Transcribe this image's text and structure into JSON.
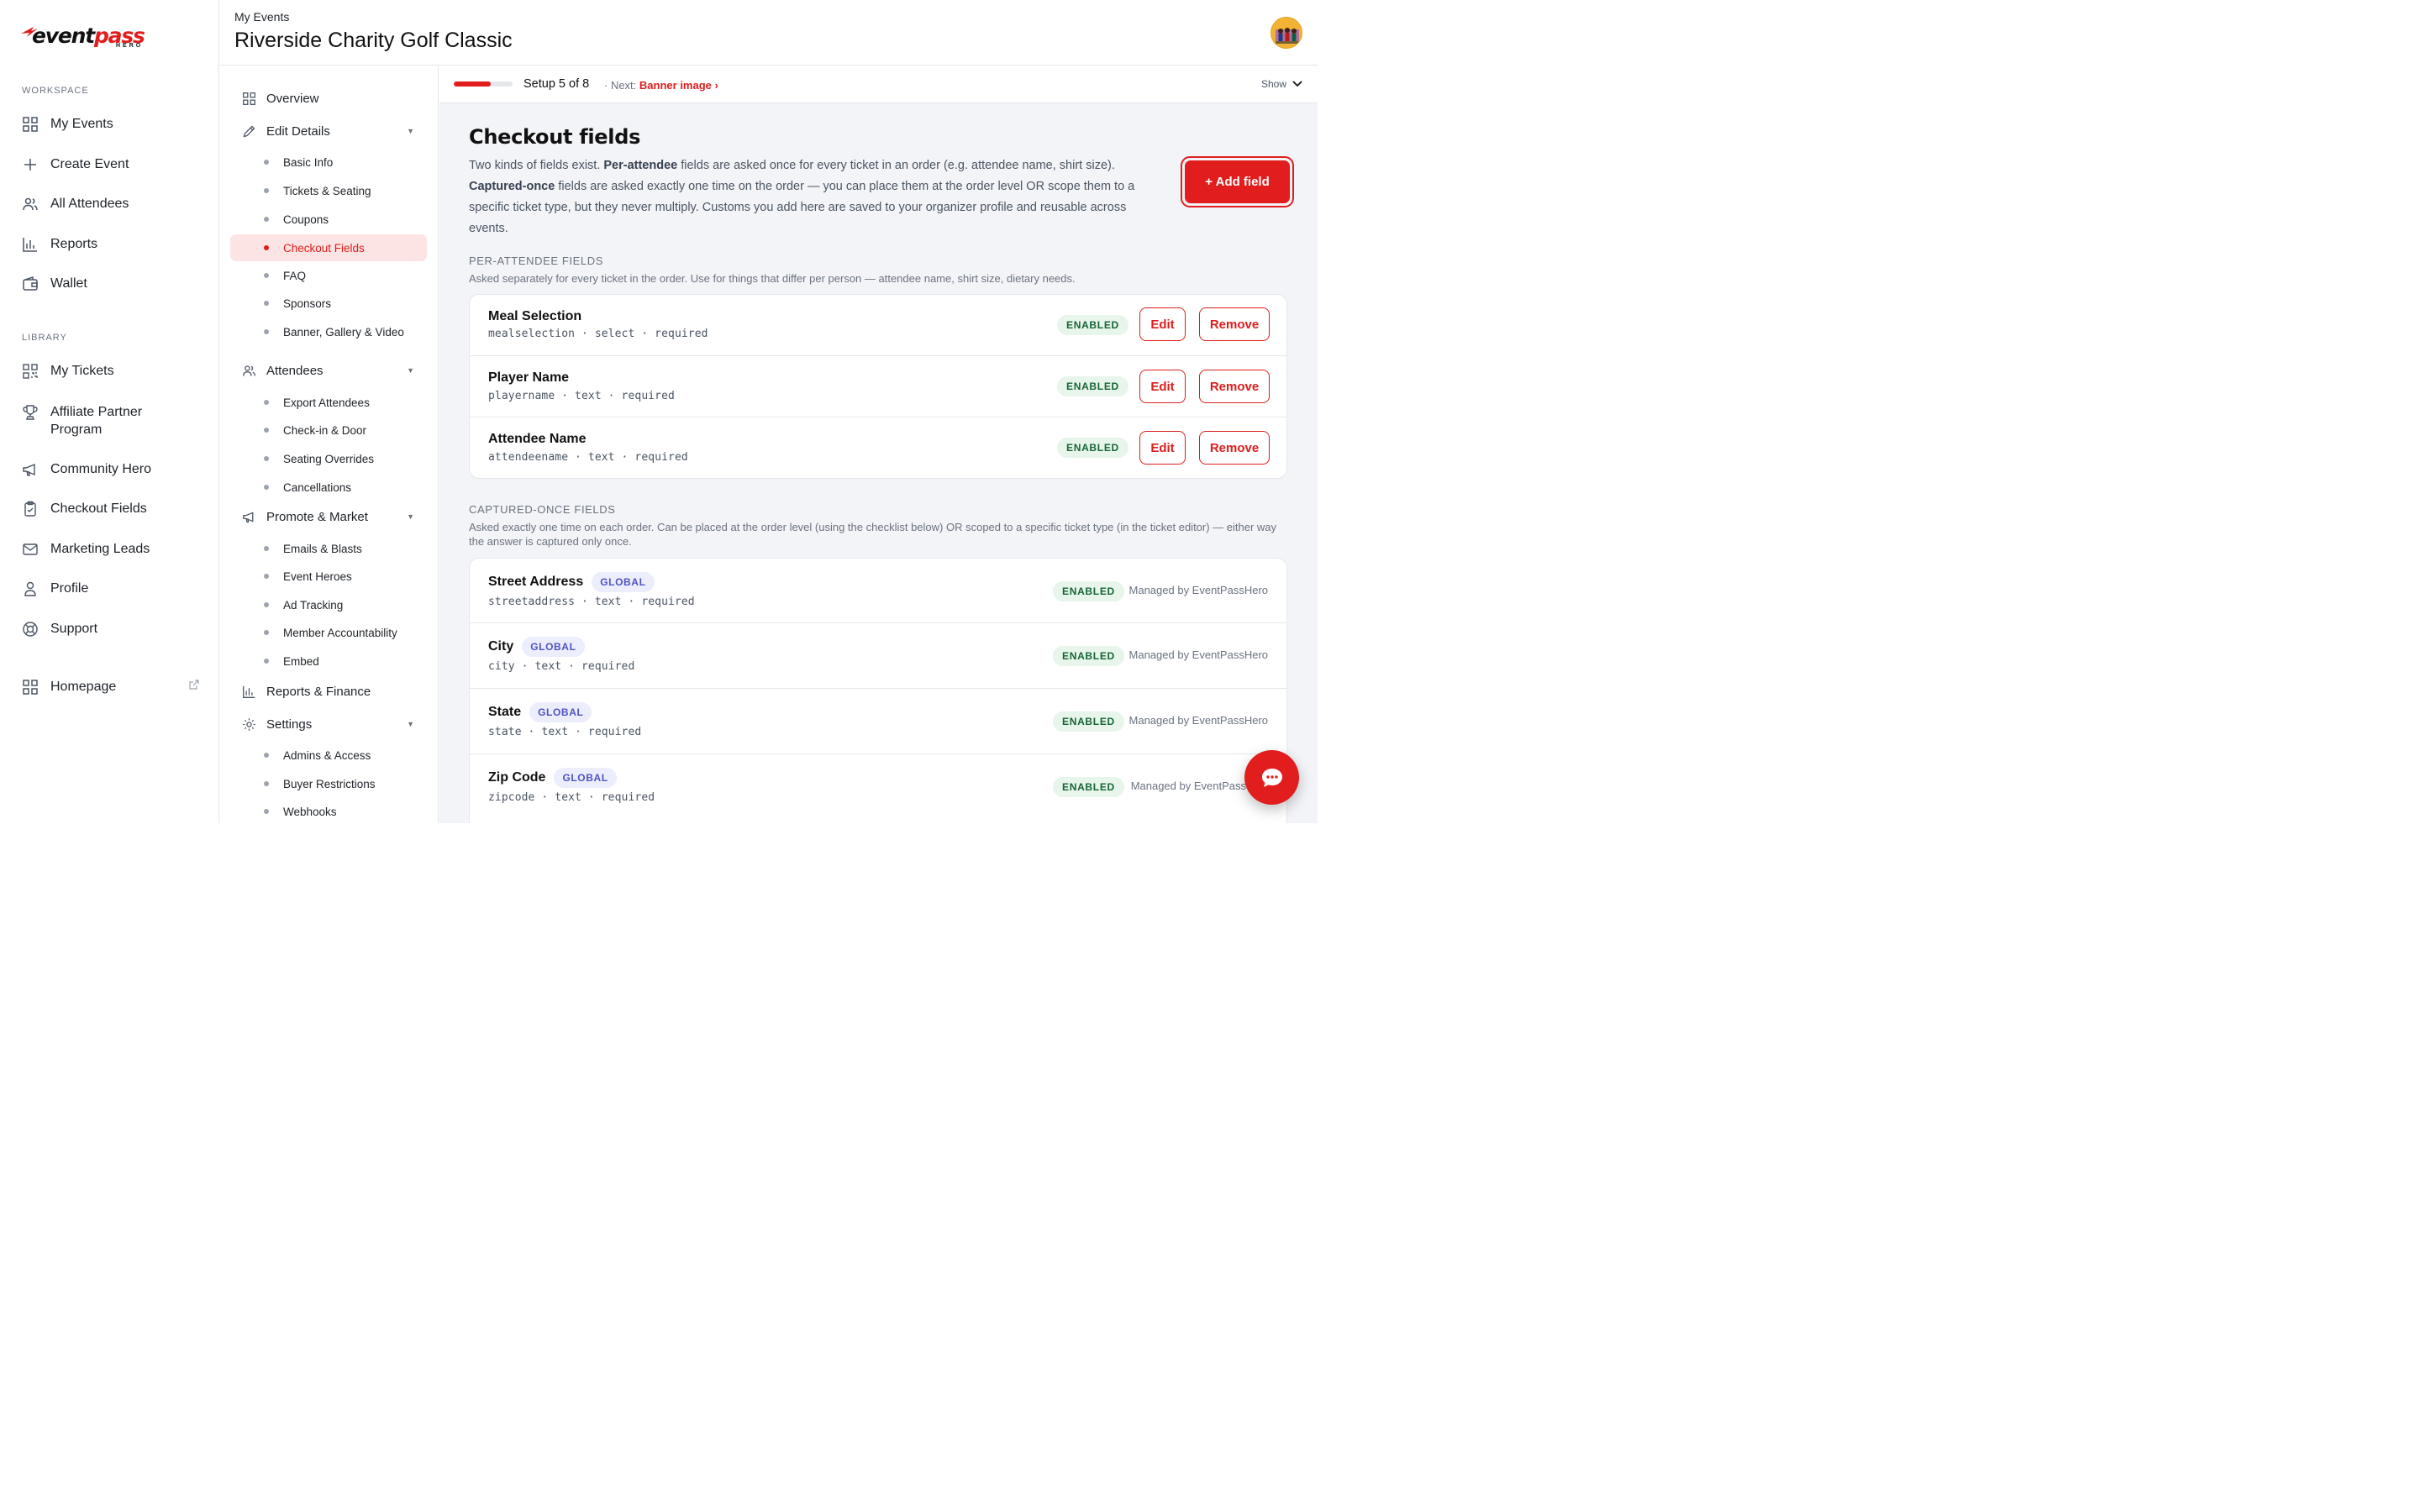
{
  "brand": {
    "logo_word_a": "event",
    "logo_word_b": "pass",
    "logo_sub": "HERO",
    "accent": "#e11d1d"
  },
  "sidebar": {
    "workspace_label": "WORKSPACE",
    "library_label": "LIBRARY",
    "workspace_items": [
      {
        "label": "My Events",
        "icon": "grid-icon"
      },
      {
        "label": "Create Event",
        "icon": "plus-icon"
      },
      {
        "label": "All Attendees",
        "icon": "users-icon"
      },
      {
        "label": "Reports",
        "icon": "bar-chart-icon"
      },
      {
        "label": "Wallet",
        "icon": "wallet-icon"
      }
    ],
    "library_items": [
      {
        "label": "My Tickets",
        "icon": "qr-icon"
      },
      {
        "label": "Affiliate Partner Program",
        "icon": "trophy-icon"
      },
      {
        "label": "Community Hero",
        "icon": "megaphone-icon"
      },
      {
        "label": "Checkout Fields",
        "icon": "clipboard-icon"
      },
      {
        "label": "Marketing Leads",
        "icon": "mail-icon"
      },
      {
        "label": "Profile",
        "icon": "user-icon"
      },
      {
        "label": "Support",
        "icon": "lifebuoy-icon"
      }
    ],
    "homepage": {
      "label": "Homepage",
      "icon": "grid-icon"
    }
  },
  "header": {
    "breadcrumb": "My Events",
    "title": "Riverside Charity Golf Classic"
  },
  "subnav": {
    "overview": "Overview",
    "edit_details": "Edit Details",
    "edit_items": [
      "Basic Info",
      "Tickets & Seating",
      "Coupons",
      "Checkout Fields",
      "FAQ",
      "Sponsors",
      "Banner, Gallery & Video"
    ],
    "attendees": "Attendees",
    "attendee_items": [
      "Export Attendees",
      "Check-in & Door",
      "Seating Overrides",
      "Cancellations"
    ],
    "promote": "Promote & Market",
    "promote_items": [
      "Emails & Blasts",
      "Event Heroes",
      "Ad Tracking",
      "Member Accountability",
      "Embed"
    ],
    "reports_finance": "Reports & Finance",
    "settings": "Settings",
    "settings_items": [
      "Admins & Access",
      "Buyer Restrictions",
      "Webhooks"
    ],
    "active": "Checkout Fields"
  },
  "setup": {
    "progress_fraction": 0.625,
    "label": "Setup 5 of 8",
    "next_prefix": "· Next:",
    "next_link": "Banner image ›",
    "show_label": "Show"
  },
  "main": {
    "title": "Checkout fields",
    "intro_a": "Two kinds of fields exist. ",
    "intro_b": "Per-attendee",
    "intro_c": " fields are asked once for every ticket in an order (e.g. attendee name, shirt size). ",
    "intro_d": "Captured-once",
    "intro_e": " fields are asked exactly one time on the order — you can place them at the order level OR scope them to a specific ticket type, but they never multiply. Customs you add here are saved to your organizer profile and reusable across events.",
    "add_button": "+ Add field",
    "per_attendee": {
      "label": "PER-ATTENDEE FIELDS",
      "desc": "Asked separately for every ticket in the order. Use for things that differ per person — attendee name, shirt size, dietary needs.",
      "fields": [
        {
          "name": "Meal Selection",
          "meta": "mealselection · select · required",
          "status": "ENABLED"
        },
        {
          "name": "Player Name",
          "meta": "playername · text · required",
          "status": "ENABLED"
        },
        {
          "name": "Attendee Name",
          "meta": "attendeename · text · required",
          "status": "ENABLED"
        }
      ],
      "edit_label": "Edit",
      "remove_label": "Remove"
    },
    "captured_once": {
      "label": "CAPTURED-ONCE FIELDS",
      "desc": "Asked exactly one time on each order. Can be placed at the order level (using the checklist below) OR scoped to a specific ticket type (in the ticket editor) — either way the answer is captured only once.",
      "fields": [
        {
          "name": "Street Address",
          "badge": "GLOBAL",
          "meta": "streetaddress · text · required",
          "status": "ENABLED",
          "managed": "Managed by EventPassHero"
        },
        {
          "name": "City",
          "badge": "GLOBAL",
          "meta": "city · text · required",
          "status": "ENABLED",
          "managed": "Managed by EventPassHero"
        },
        {
          "name": "State",
          "badge": "GLOBAL",
          "meta": "state · text · required",
          "status": "ENABLED",
          "managed": "Managed by EventPassHero"
        },
        {
          "name": "Zip Code",
          "badge": "GLOBAL",
          "meta": "zipcode · text · required",
          "status": "ENABLED",
          "managed": "Managed by EventPass"
        }
      ]
    }
  },
  "chat": {
    "icon": "chat-icon"
  }
}
